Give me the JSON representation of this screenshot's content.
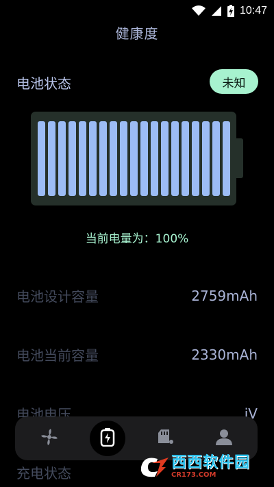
{
  "status_bar": {
    "time": "10:47",
    "icons": [
      "wifi-icon",
      "cellular-signal-icon",
      "battery-charging-icon"
    ]
  },
  "page": {
    "title": "健康度"
  },
  "battery_status": {
    "title": "电池状态",
    "chip": "未知",
    "level_percent": 100,
    "level_text": "当前电量为：100%",
    "cell_color": "#9cbcf5",
    "body_color": "#25302a"
  },
  "info_rows": [
    {
      "label": "电池设计容量",
      "value": "2759mAh"
    },
    {
      "label": "电池当前容量",
      "value": "2330mAh"
    },
    {
      "label": "电池电压",
      "value": "iV"
    },
    {
      "label": "充电状态",
      "value": ""
    }
  ],
  "bottom_nav": {
    "items": [
      {
        "icon": "fan-icon",
        "active": false
      },
      {
        "icon": "battery-bolt-icon",
        "active": true
      },
      {
        "icon": "storage-card-icon",
        "active": false
      },
      {
        "icon": "person-icon",
        "active": false
      }
    ]
  },
  "watermark": {
    "main": "西西软件园",
    "sub": "CR173.COM"
  },
  "colors": {
    "accent_green": "#a7f2cf",
    "accent_blue": "#9cbcf5",
    "text_dim": "#434a5c",
    "text_value": "#a9b3d6"
  }
}
